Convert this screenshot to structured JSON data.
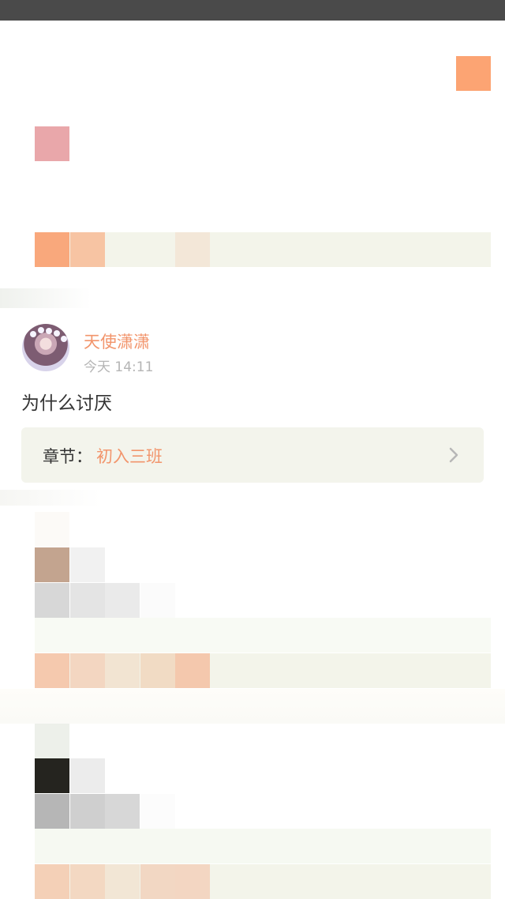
{
  "comment": {
    "username": "天使潇潇",
    "time": "今天 14:11",
    "text": "为什么讨厌",
    "chapter_label": "章节：",
    "chapter_name": "初入三班"
  },
  "icons": {
    "avatar": "avatar-image",
    "chevron": "chevron-right-icon"
  },
  "colors": {
    "status_bar": "#4a4a4a",
    "accent": "#f2956c",
    "card_background": "#f3f4ec",
    "text": "#333333",
    "muted_text": "#b5b5b5"
  }
}
